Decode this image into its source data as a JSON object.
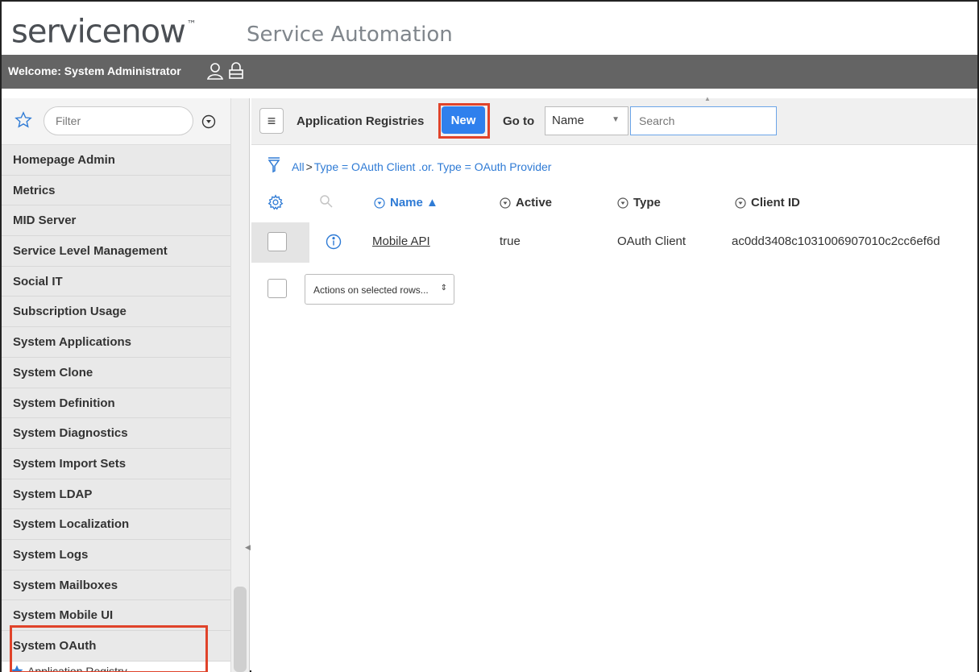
{
  "banner": {
    "logo_text": "servicenow",
    "logo_trademark": "™",
    "subtitle": "Service Automation"
  },
  "welcome": {
    "text": "Welcome: System Administrator",
    "icons": [
      "user-icon",
      "lock-icon"
    ]
  },
  "sidebar": {
    "filter_placeholder": "Filter",
    "items": [
      "Homepage Admin",
      "Metrics",
      "MID Server",
      "Service Level Management",
      "Social IT",
      "Subscription Usage",
      "System Applications",
      "System Clone",
      "System Definition",
      "System Diagnostics",
      "System Import Sets",
      "System LDAP",
      "System Localization",
      "System Logs",
      "System Mailboxes",
      "System Mobile UI",
      "System OAuth"
    ],
    "sub_item": "Application Registry"
  },
  "toolbar": {
    "title": "Application Registries",
    "new_label": "New",
    "goto_label": "Go to",
    "goto_field": "Name",
    "search_placeholder": "Search"
  },
  "breadcrumb": {
    "all": "All",
    "separator": ">",
    "condition": "Type = OAuth Client .or. Type = OAuth Provider"
  },
  "table": {
    "columns": [
      "Name ▲",
      "Active",
      "Type",
      "Client ID"
    ],
    "rows": [
      {
        "name": "Mobile API",
        "active": "true",
        "type": "OAuth Client",
        "client_id": "ac0dd3408c1031006907010c2cc6ef6d"
      }
    ]
  },
  "actions": {
    "label": "Actions on selected rows..."
  },
  "colors": {
    "accent_blue": "#2f80ed",
    "highlight_red": "#e0432a",
    "header_bar": "#646464"
  }
}
